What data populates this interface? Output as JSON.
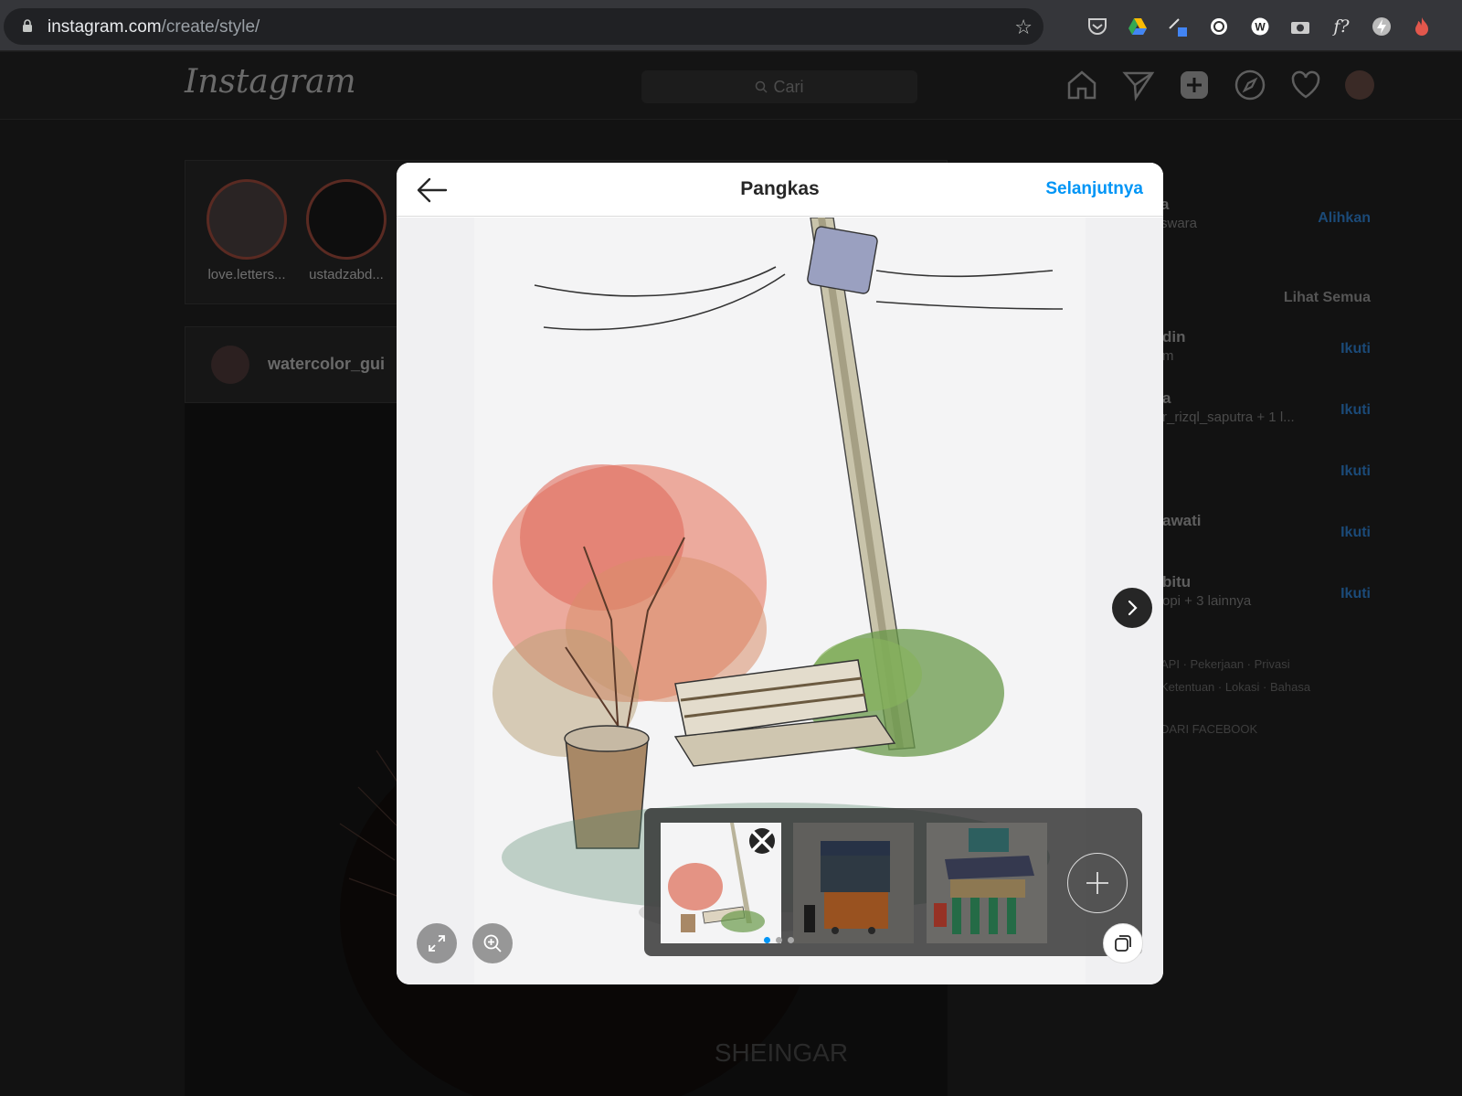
{
  "browser": {
    "url_host": "instagram.com",
    "url_path": "/create/style/",
    "extensions": [
      "pocket-icon",
      "google-drive-icon",
      "eyedropper-icon",
      "ext-icon",
      "wordpress-icon",
      "camera-icon",
      "font-finder-icon",
      "bolt-icon",
      "fire-icon"
    ],
    "font_ext_label": "f?"
  },
  "instagram": {
    "logo": "Instagram",
    "search_placeholder": "Cari",
    "stories": [
      {
        "name": "love.letters..."
      },
      {
        "name": "ustadzabd..."
      }
    ],
    "post_username": "watercolor_gui",
    "sidebar": {
      "profile_name": "a",
      "profile_sub": "swara",
      "switch_label": "Alihkan",
      "see_all": "Lihat Semua",
      "suggestions": [
        {
          "name": "din",
          "sub": "m",
          "action": "Ikuti"
        },
        {
          "name": "a",
          "sub": "r_rizql_saputra + 1 l...",
          "action": "Ikuti"
        },
        {
          "name": "",
          "sub": "",
          "action": "Ikuti"
        },
        {
          "name": "awati",
          "sub": "",
          "action": "Ikuti"
        },
        {
          "name": "bitu",
          "sub": "opi + 3 lainnya",
          "action": "Ikuti"
        }
      ],
      "footer_line1": "API · Pekerjaan · Privasi",
      "footer_line2": "Ketentuan · Lokasi · Bahasa",
      "footer_line3": "DARI FACEBOOK"
    },
    "watermark": "SHEINGAR"
  },
  "modal": {
    "title": "Pangkas",
    "next_label": "Selanjutnya",
    "current_slide": 1,
    "total_slides": 3,
    "thumbnails": [
      {
        "name": "thumb-bench-tree",
        "selected": true
      },
      {
        "name": "thumb-food-cart-orange",
        "selected": false
      },
      {
        "name": "thumb-food-cart-green",
        "selected": false
      }
    ]
  }
}
